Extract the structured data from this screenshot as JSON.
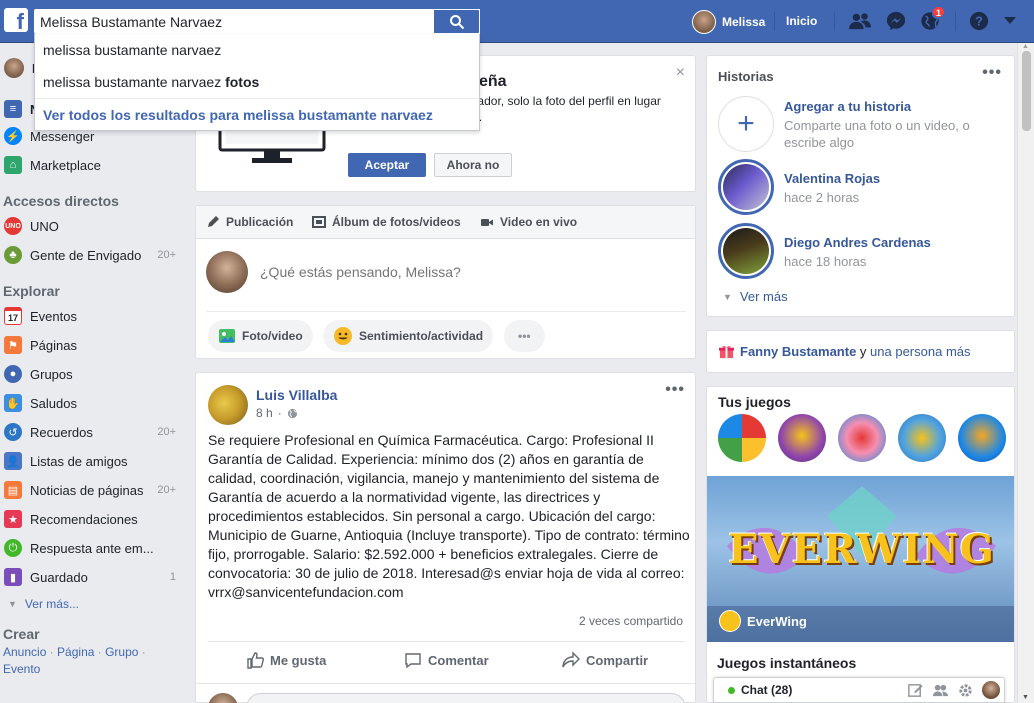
{
  "topbar": {
    "logo": "f",
    "search_value": "Melissa Bustamante Narvaez",
    "user_name": "Melissa",
    "home_label": "Inicio",
    "notification_count": "1",
    "help_label": "?"
  },
  "search_dropdown": {
    "suggestion_1": "melissa bustamante narvaez",
    "suggestion_2_prefix": "melissa bustamante narvaez ",
    "suggestion_2_bold": "fotos",
    "see_all": "Ver todos los resultados para melissa bustamante narvaez"
  },
  "left_nav": {
    "profile_short": "M",
    "news_feed_short": "N",
    "messenger": "Messenger",
    "marketplace": "Marketplace",
    "shortcuts_title": "Accesos directos",
    "shortcuts": [
      {
        "label": "UNO",
        "count": ""
      },
      {
        "label": "Gente de Envigado",
        "count": "20+"
      }
    ],
    "explore_title": "Explorar",
    "explore": [
      {
        "label": "Eventos",
        "count": "",
        "icon": "calendar-icon",
        "calendar_day": "17"
      },
      {
        "label": "Páginas",
        "count": "",
        "icon": "flag-icon"
      },
      {
        "label": "Grupos",
        "count": "",
        "icon": "groups-icon"
      },
      {
        "label": "Saludos",
        "count": "",
        "icon": "wave-icon"
      },
      {
        "label": "Recuerdos",
        "count": "20+",
        "icon": "memories-icon"
      },
      {
        "label": "Listas de amigos",
        "count": "",
        "icon": "friend-lists-icon"
      },
      {
        "label": "Noticias de páginas",
        "count": "20+",
        "icon": "page-feed-icon"
      },
      {
        "label": "Recomendaciones",
        "count": "",
        "icon": "recommendations-icon"
      },
      {
        "label": "Respuesta ante em...",
        "count": "",
        "icon": "crisis-response-icon"
      },
      {
        "label": "Guardado",
        "count": "1",
        "icon": "bookmark-icon"
      }
    ],
    "see_more": "Ver más...",
    "create_title": "Crear",
    "create_links": [
      "Anuncio",
      "Página",
      "Grupo",
      "Evento"
    ]
  },
  "password_card": {
    "title_fragment": "eña",
    "text": "es sesión en este navegador, solo la foto del perfil en lugar de escribir la contraseña.",
    "accept": "Aceptar",
    "not_now": "Ahora no",
    "close": "×"
  },
  "composer": {
    "tabs": [
      "Publicación",
      "Álbum de fotos/videos",
      "Video en vivo"
    ],
    "placeholder": "¿Qué estás pensando, Melissa?",
    "photo_video": "Foto/video",
    "feeling": "Sentimiento/actividad",
    "more": "•••"
  },
  "post": {
    "author": "Luis Villalba",
    "time": "8 h",
    "text": "Se requiere Profesional en Química Farmacéutica. Cargo: Profesional II Garantía de Calidad. Experiencia: mínimo dos (2) años en garantía de calidad, coordinación, vigilancia, manejo y mantenimiento del sistema de Garantía de acuerdo a la normatividad vigente, las directrices y procedimientos establecidos. Sin personal a cargo. Ubicación del cargo: Municipio de Guarne, Antioquia (Incluye transporte). Tipo de contrato: término fijo, prorrogable. Salario: $2.592.000 + beneficios extralegales. Cierre de convocatoria: 30 de julio de 2018. Interesad@s enviar hoja de vida al correo: vrrx@sanvicentefundacion.com",
    "shares": "2 veces compartido",
    "like": "Me gusta",
    "comment": "Comentar",
    "share": "Compartir",
    "more": "•••"
  },
  "stories": {
    "title": "Historias",
    "more": "•••",
    "add_title": "Agregar a tu historia",
    "add_sub": "Comparte una foto o un video, o escribe algo",
    "items": [
      {
        "name": "Valentina Rojas",
        "time": "hace 2 horas"
      },
      {
        "name": "Diego Andres Cardenas",
        "time": "hace 18 horas"
      }
    ],
    "see_more": "Ver más"
  },
  "birthday": {
    "name": "Fanny Bustamante",
    "connector": " y ",
    "others": "una persona más"
  },
  "games": {
    "title": "Tus juegos",
    "banner_title": "EVERWING",
    "banner_name": "EverWing",
    "instant_title": "Juegos instantáneos"
  },
  "chat": {
    "label": "Chat (28)"
  },
  "colors": {
    "brand": "#4267b2",
    "link": "#365899",
    "online": "#42b72a",
    "badge": "#fa3e3e"
  }
}
